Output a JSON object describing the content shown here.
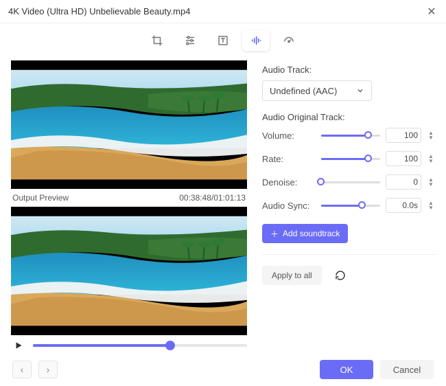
{
  "titlebar": {
    "title": "4K Video (Ultra HD) Unbelievable Beauty.mp4"
  },
  "toolbar": {
    "tools": [
      {
        "name": "crop-icon"
      },
      {
        "name": "adjust-icon"
      },
      {
        "name": "text-icon"
      },
      {
        "name": "audio-icon",
        "selected": true
      },
      {
        "name": "speed-icon"
      }
    ]
  },
  "left": {
    "output_label": "Output Preview",
    "timecode": "00:38:48/01:01:13",
    "seek_percent": 64
  },
  "audio": {
    "track_label": "Audio Track:",
    "track_value": "Undefined (AAC)",
    "original_label": "Audio Original Track:",
    "rows": [
      {
        "label": "Volume:",
        "value": "100",
        "percent": 80
      },
      {
        "label": "Rate:",
        "value": "100",
        "percent": 80
      },
      {
        "label": "Denoise:",
        "value": "0",
        "percent": 0
      },
      {
        "label": "Audio Sync:",
        "value": "0.0s",
        "percent": 70
      }
    ],
    "add_label": "Add soundtrack",
    "apply_label": "Apply to all"
  },
  "footer": {
    "ok": "OK",
    "cancel": "Cancel"
  }
}
